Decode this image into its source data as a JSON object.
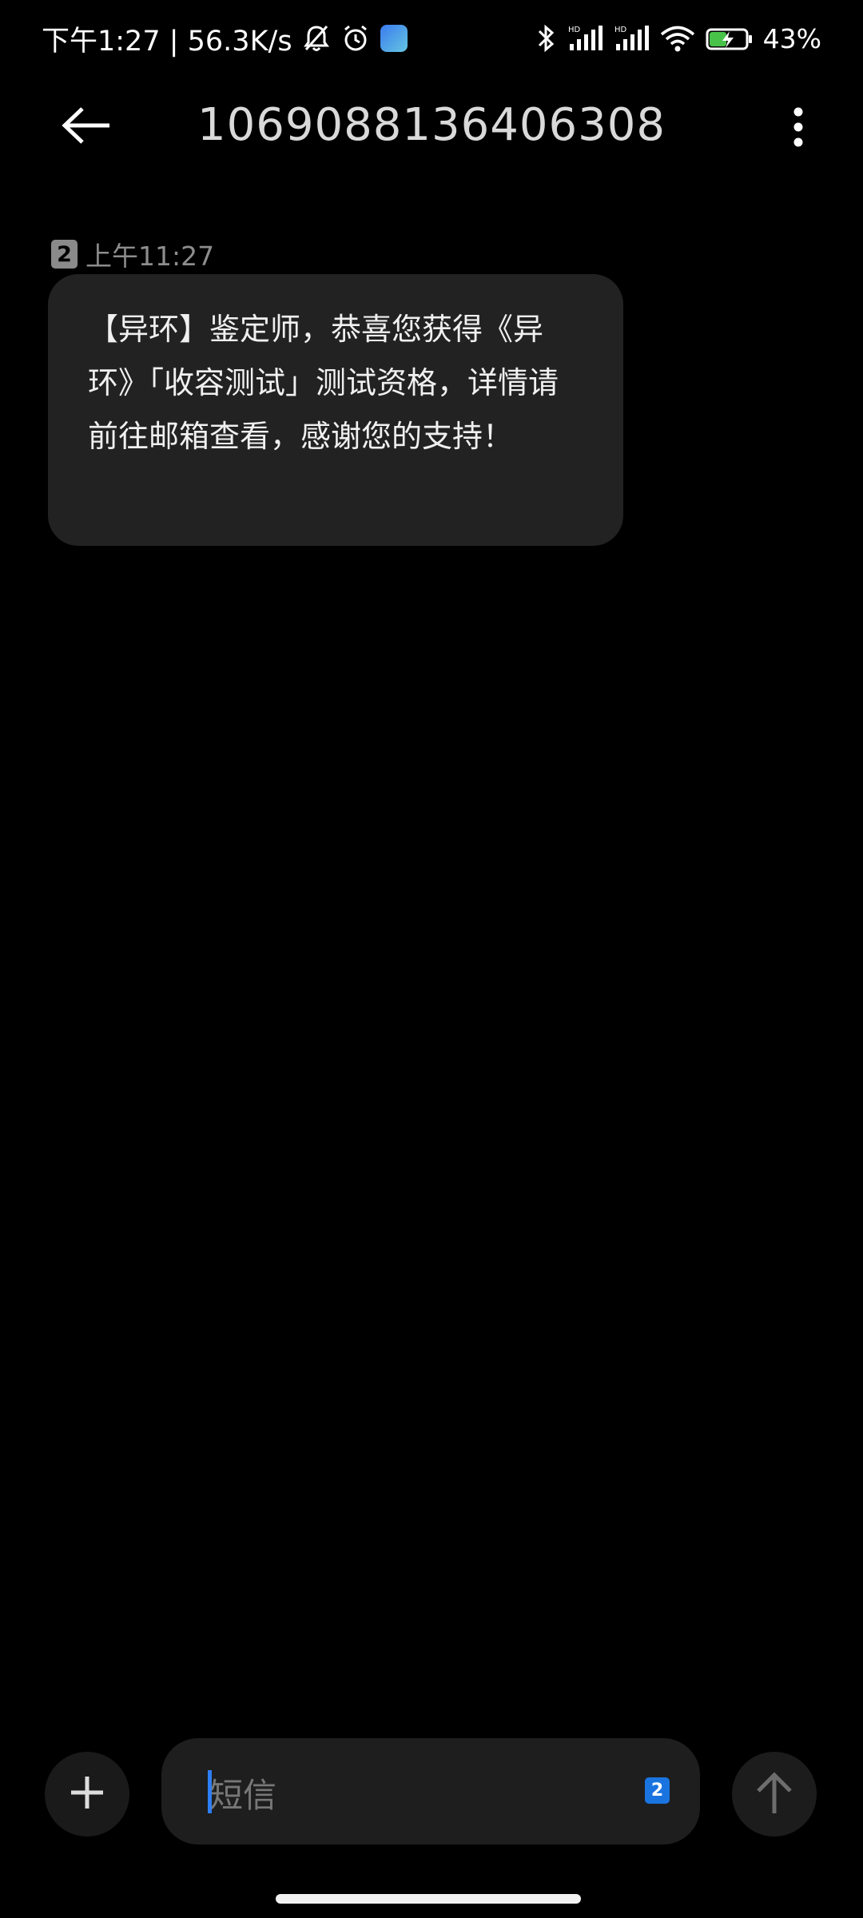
{
  "status_bar": {
    "time_speed": "下午1:27 | 56.3K/s",
    "battery": "43%",
    "icons": [
      "mute-bell-icon",
      "alarm-icon",
      "app-icon",
      "bluetooth-icon",
      "signal-hd-1-icon",
      "signal-hd-2-icon",
      "wifi-icon",
      "battery-charging-icon"
    ]
  },
  "header": {
    "title": "1069088136406308",
    "back_icon": "arrow-left-icon",
    "more_icon": "more-vertical-icon"
  },
  "message": {
    "sim": "2",
    "time": "上午11:27",
    "text": "【异环】鉴定师，恭喜您获得《异环》「收容测试」测试资格，详情请前往邮箱查看，感谢您的支持！"
  },
  "composer": {
    "placeholder": "短信",
    "sim": "2",
    "add_icon": "plus-icon",
    "send_icon": "arrow-up-icon"
  },
  "colors": {
    "background": "#000000",
    "bubble": "#222222",
    "accent": "#1a74e0"
  }
}
